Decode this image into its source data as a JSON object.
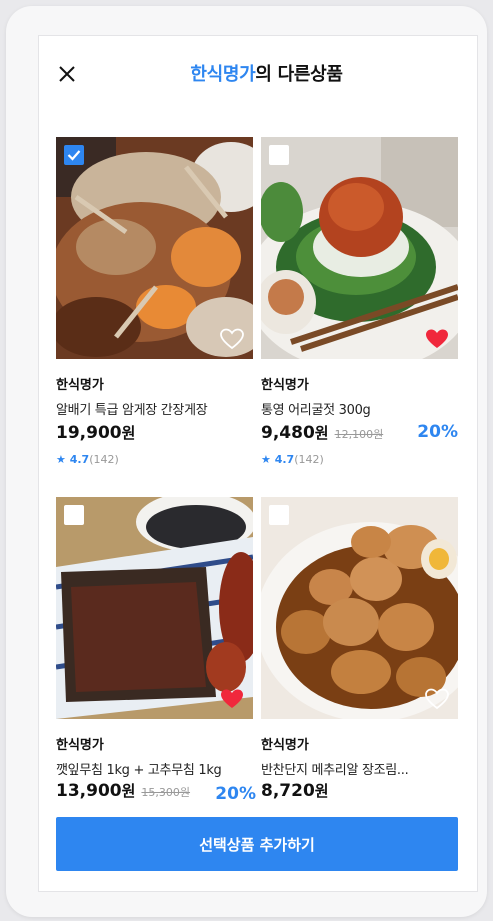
{
  "header": {
    "brand": "한식명가",
    "title_suffix": "의 다른상품"
  },
  "products": [
    {
      "seller": "한식명가",
      "name": "알배기 특급 암게장 간장게장",
      "price": "19,900",
      "unit": "원",
      "rating": "4.7",
      "reviews": "(142)",
      "checked": true,
      "liked": false
    },
    {
      "seller": "한식명가",
      "name": "통영 어리굴젓 300g",
      "price": "9,480",
      "unit": "원",
      "original_price": "12,100원",
      "discount": "20%",
      "rating": "4.7",
      "reviews": "(142)",
      "checked": false,
      "liked": true
    },
    {
      "seller": "한식명가",
      "name": "깻잎무침 1kg + 고추무침 1kg",
      "price": "13,900",
      "unit": "원",
      "original_price": "15,300원",
      "discount": "20%",
      "checked": false,
      "liked": true
    },
    {
      "seller": "한식명가",
      "name": "반찬단지 메추리알 장조림...",
      "price": "8,720",
      "unit": "원",
      "checked": false,
      "liked": false
    }
  ],
  "add_button_label": "선택상품 추가하기",
  "colors": {
    "accent": "#2e86f0",
    "heart_active": "#f0283c"
  },
  "icons": {
    "close": "close-icon",
    "checkbox": "checkbox-icon",
    "heart": "heart-icon",
    "star": "star-icon"
  }
}
